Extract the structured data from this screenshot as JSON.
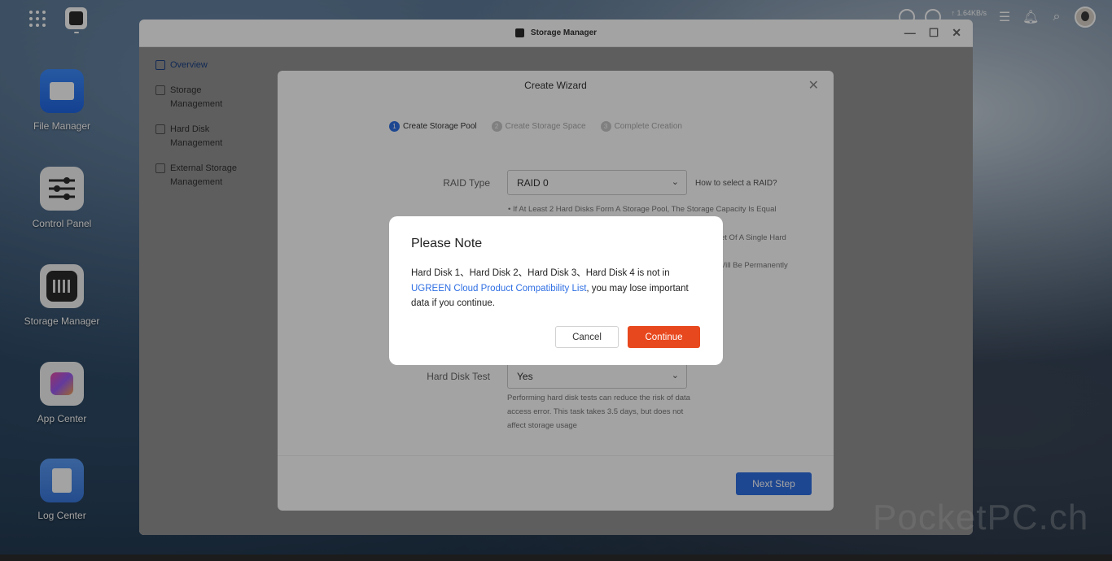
{
  "topbar": {
    "net_speed": "↑ 1.64KB/s"
  },
  "desktop": {
    "icons": [
      {
        "label": "File Manager"
      },
      {
        "label": "Control Panel"
      },
      {
        "label": "Storage Manager"
      },
      {
        "label": "App Center"
      },
      {
        "label": "Log Center"
      }
    ]
  },
  "window": {
    "title": "Storage Manager",
    "sidebar": [
      {
        "label": "Overview"
      },
      {
        "label": "Storage Management"
      },
      {
        "label": "Hard Disk Management"
      },
      {
        "label": "External Storage Management"
      }
    ]
  },
  "wizard": {
    "title": "Create Wizard",
    "steps": [
      {
        "num": "1",
        "label": "Create Storage Pool"
      },
      {
        "num": "2",
        "label": "Create Storage Space"
      },
      {
        "num": "3",
        "label": "Complete Creation"
      }
    ],
    "raid_label": "RAID Type",
    "raid_value": "RAID 0",
    "raid_help": "How to select a RAID?",
    "raid_note_1": "• If At Least 2 Hard Disks Form A Storage Pool, The Storage Capacity Is Equal",
    "raid_note_2": "et Of A Single Hard",
    "raid_note_3": "Vill Be Permanently",
    "test_label": "Hard Disk Test",
    "test_value": "Yes",
    "test_note": "Performing hard disk tests can reduce the risk of data access error. This task takes 3.5 days, but does not affect storage usage",
    "next_button": "Next Step"
  },
  "dialog": {
    "title": "Please Note",
    "body_before": "Hard Disk 1、Hard Disk 2、Hard Disk 3、Hard Disk 4 is not in",
    "link": "UGREEN Cloud Product Compatibility List",
    "body_after": ", you may lose important data if you continue.",
    "cancel": "Cancel",
    "continue": "Continue"
  },
  "watermark": "PocketPC.ch",
  "colors": {
    "accent": "#2f6fe3",
    "danger": "#e8481d"
  }
}
